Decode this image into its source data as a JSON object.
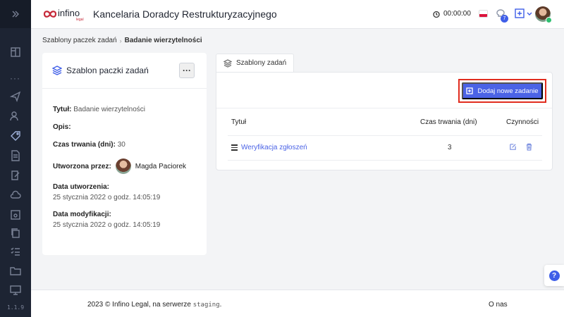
{
  "header": {
    "logo_text": "infino",
    "logo_sub": "legal",
    "title": "Kancelaria Doradcy Restrukturyzacyjnego",
    "timer": "00:00:00",
    "notifications_count": "7"
  },
  "sidebar": {
    "version": "1.1.9"
  },
  "breadcrumb": {
    "parent": "Szablony paczek zadań",
    "separator": "›",
    "current": "Badanie wierzytelności"
  },
  "template_card": {
    "title": "Szablon paczki zadań",
    "menu_label": "···",
    "fields": {
      "title_label": "Tytuł:",
      "title_value": "Badanie wierzytelności",
      "description_label": "Opis:",
      "duration_label": "Czas trwania (dni):",
      "duration_value": "30",
      "created_by_label": "Utworzona przez:",
      "created_by_value": "Magda Paciorek",
      "created_label": "Data utworzenia:",
      "created_value": "25 stycznia 2022 o godz. 14:05:19",
      "modified_label": "Data modyfikacji:",
      "modified_value": "25 stycznia 2022 o godz. 14:05:19"
    }
  },
  "tasks": {
    "tab_label": "Szablony zadań",
    "add_button": "Dodaj nowe zadanie",
    "columns": {
      "title": "Tytuł",
      "duration": "Czas trwania (dni)",
      "actions": "Czynności"
    },
    "rows": [
      {
        "title": "Weryfikacja zgłoszeń",
        "duration": "3"
      }
    ]
  },
  "footer": {
    "copyright": "2023 © Infino Legal, na serwerze",
    "server": "staging",
    "period": ".",
    "about_link": "O nas"
  },
  "help": {
    "label": "?"
  },
  "colors": {
    "accent": "#4b63e6",
    "highlight": "#e12d1f",
    "sidebar": "#1d2433"
  }
}
